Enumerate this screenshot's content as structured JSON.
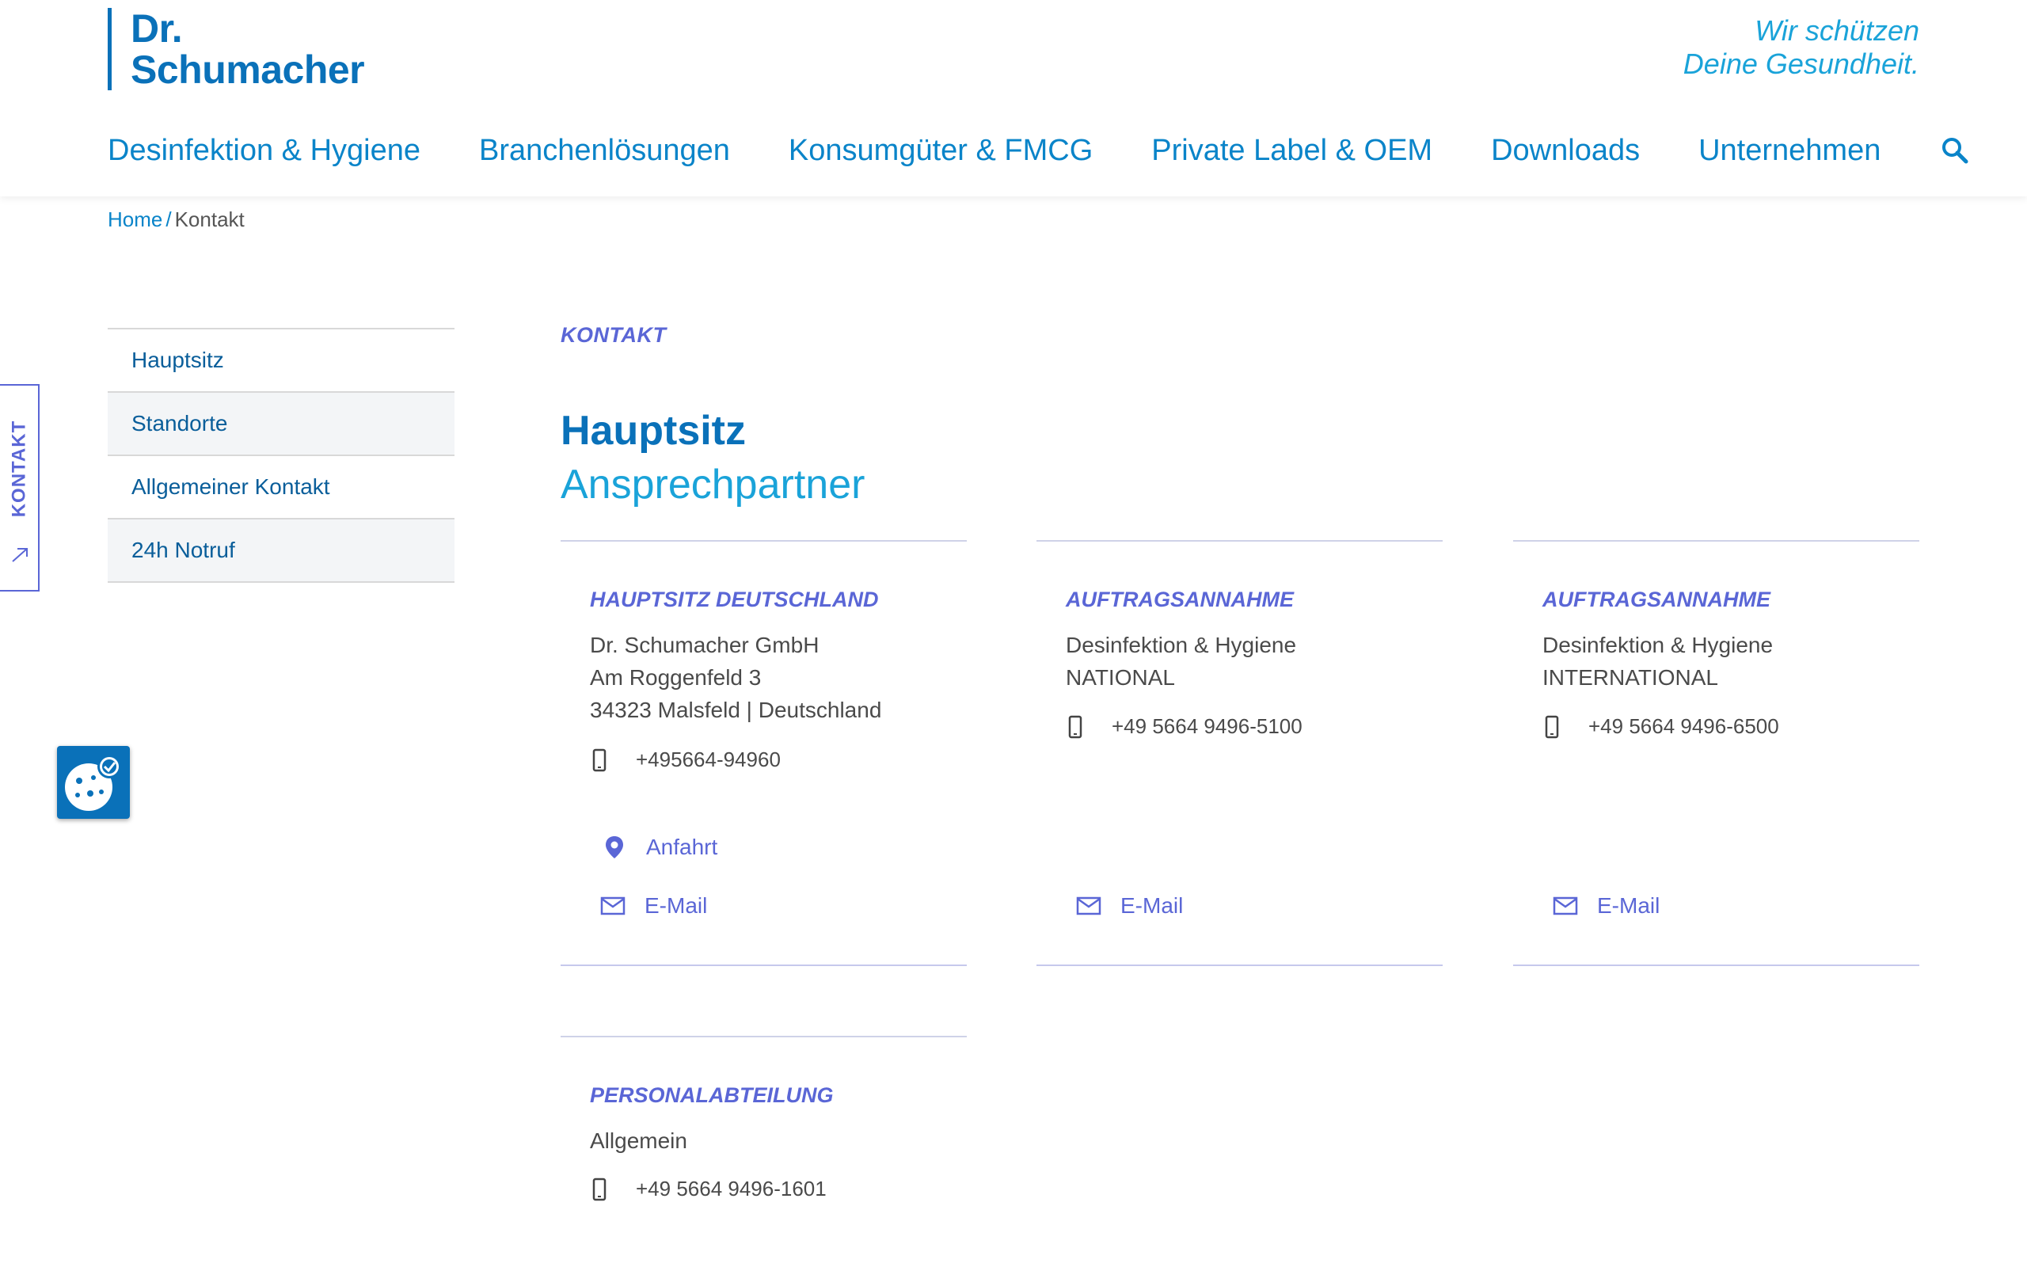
{
  "logo": {
    "line1": "Dr.",
    "line2": "Schumacher"
  },
  "tagline": {
    "line1": "Wir schützen",
    "line2": "Deine Gesundheit."
  },
  "nav": [
    {
      "label": "Desinfektion & Hygiene"
    },
    {
      "label": "Branchenlösungen"
    },
    {
      "label": "Konsumgüter & FMCG"
    },
    {
      "label": "Private Label & OEM"
    },
    {
      "label": "Downloads"
    },
    {
      "label": "Unternehmen"
    }
  ],
  "breadcrumb": {
    "home": "Home",
    "separator": "/",
    "current": "Kontakt"
  },
  "side_tab": {
    "label": "KONTAKT"
  },
  "submenu": [
    {
      "label": "Hauptsitz"
    },
    {
      "label": "Standorte"
    },
    {
      "label": "Allgemeiner Kontakt"
    },
    {
      "label": "24h Notruf"
    }
  ],
  "content": {
    "eyebrow": "KONTAKT",
    "title": "Hauptsitz",
    "subtitle": "Ansprechpartner"
  },
  "cards": [
    {
      "heading": "HAUPTSITZ DEUTSCHLAND",
      "lines": [
        "Dr. Schumacher GmbH",
        "Am Roggenfeld 3",
        "34323 Malsfeld | Deutschland"
      ],
      "phone": "+495664-94960",
      "directions": "Anfahrt",
      "email": "E-Mail"
    },
    {
      "heading": "AUFTRAGSANNAHME",
      "lines": [
        "Desinfektion & Hygiene",
        "NATIONAL"
      ],
      "phone": "+49 5664 9496-5100",
      "email": "E-Mail"
    },
    {
      "heading": "AUFTRAGSANNAHME",
      "lines": [
        "Desinfektion & Hygiene",
        "INTERNATIONAL"
      ],
      "phone": "+49 5664 9496-6500",
      "email": "E-Mail"
    },
    {
      "heading": "PERSONALABTEILUNG",
      "lines": [
        "Allgemein"
      ],
      "phone": "+49 5664 9496-1601"
    }
  ],
  "icons": {
    "search": "search-icon",
    "phone": "mobile-phone-icon",
    "location": "location-pin-icon",
    "mail": "mail-icon",
    "cookie": "cookie-settings-icon",
    "arrow": "arrow-up-right-icon"
  },
  "colors": {
    "brand_blue": "#0a71b9",
    "link_blue": "#0a84c9",
    "light_blue": "#1aa3d9",
    "accent_violet": "#5a66d6"
  }
}
